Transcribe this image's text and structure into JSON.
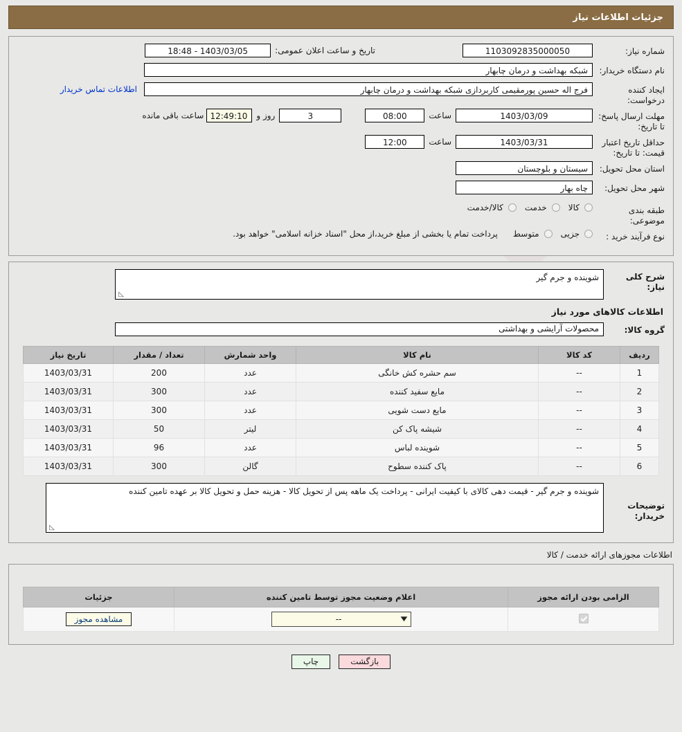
{
  "header": {
    "title": "جزئیات اطلاعات نیاز"
  },
  "form": {
    "need_number_label": "شماره نیاز:",
    "need_number_value": "1103092835000050",
    "announce_label": "تاریخ و ساعت اعلان عمومی:",
    "announce_value": "1403/03/05 - 18:48",
    "buyer_org_label": "نام دستگاه خریدار:",
    "buyer_org_value": "شبکه بهداشت و درمان چابهار",
    "creator_label": "ایجاد کننده درخواست:",
    "creator_value": "فرج اله حسین پورمقیمی کاربردازی شبکه بهداشت و درمان چابهار",
    "contact_link": "اطلاعات تماس خریدار",
    "deadline_label": "مهلت ارسال پاسخ: تا تاریخ:",
    "deadline_date": "1403/03/09",
    "hour_label": "ساعت",
    "deadline_time": "08:00",
    "days_remaining": "3",
    "days_label": "روز و",
    "countdown": "12:49:10",
    "countdown_label": "ساعت باقی مانده",
    "price_validity_label": "حداقل تاریخ اعتبار قیمت: تا تاریخ:",
    "price_validity_date": "1403/03/31",
    "price_validity_time": "12:00",
    "province_label": "استان محل تحویل:",
    "province_value": "سیستان و بلوچستان",
    "city_label": "شهر محل تحویل:",
    "city_value": "چاه بهار",
    "category_label": "طبقه بندی موضوعی:",
    "category_options": [
      "کالا",
      "خدمت",
      "کالا/خدمت"
    ],
    "process_label": "نوع فرآیند خرید :",
    "process_options": [
      "جزیی",
      "متوسط"
    ],
    "process_note": "پرداخت تمام یا بخشی از مبلغ خرید،از محل \"اسناد خزانه اسلامی\" خواهد بود."
  },
  "need": {
    "summary_label": "شرح کلی نیاز:",
    "summary_value": "شوینده و جرم گیر",
    "goods_section_title": "اطلاعات کالاهای مورد نیاز",
    "goods_group_label": "گروه کالا:",
    "goods_group_value": "محصولات آرایشی و بهداشتی"
  },
  "goods_table": {
    "columns": [
      "ردیف",
      "کد کالا",
      "نام کالا",
      "واحد شمارش",
      "تعداد / مقدار",
      "تاریخ نیاز"
    ],
    "rows": [
      {
        "row": "1",
        "code": "--",
        "name": "سم حشره کش خانگی",
        "unit": "عدد",
        "qty": "200",
        "date": "1403/03/31"
      },
      {
        "row": "2",
        "code": "--",
        "name": "مایع سفید کننده",
        "unit": "عدد",
        "qty": "300",
        "date": "1403/03/31"
      },
      {
        "row": "3",
        "code": "--",
        "name": "مایع دست شویی",
        "unit": "عدد",
        "qty": "300",
        "date": "1403/03/31"
      },
      {
        "row": "4",
        "code": "--",
        "name": "شیشه پاک کن",
        "unit": "لیتر",
        "qty": "50",
        "date": "1403/03/31"
      },
      {
        "row": "5",
        "code": "--",
        "name": "شوینده لباس",
        "unit": "عدد",
        "qty": "96",
        "date": "1403/03/31"
      },
      {
        "row": "6",
        "code": "--",
        "name": "پاک کننده سطوح",
        "unit": "گالن",
        "qty": "300",
        "date": "1403/03/31"
      }
    ]
  },
  "buyer_notes": {
    "label": "توضیحات خریدار:",
    "value": "شوینده و جرم گیر - قیمت دهی کالای با کیفیت ایرانی - پرداخت یک ماهه پس از تحویل کالا - هزینه حمل و تحویل کالا بر عهده تامین کننده"
  },
  "permits": {
    "section_title": "اطلاعات مجوزهای ارائه خدمت / کالا",
    "columns": [
      "الزامی بودن ارائه مجوز",
      "اعلام وضعیت مجوز توسط تامین کننده",
      "جزئیات"
    ],
    "rows": [
      {
        "required": true,
        "status": "--",
        "details_button": "مشاهده مجوز"
      }
    ]
  },
  "footer": {
    "back_button": "بازگشت",
    "print_button": "چاپ"
  },
  "watermark": {
    "text": "AriaTender.net"
  }
}
